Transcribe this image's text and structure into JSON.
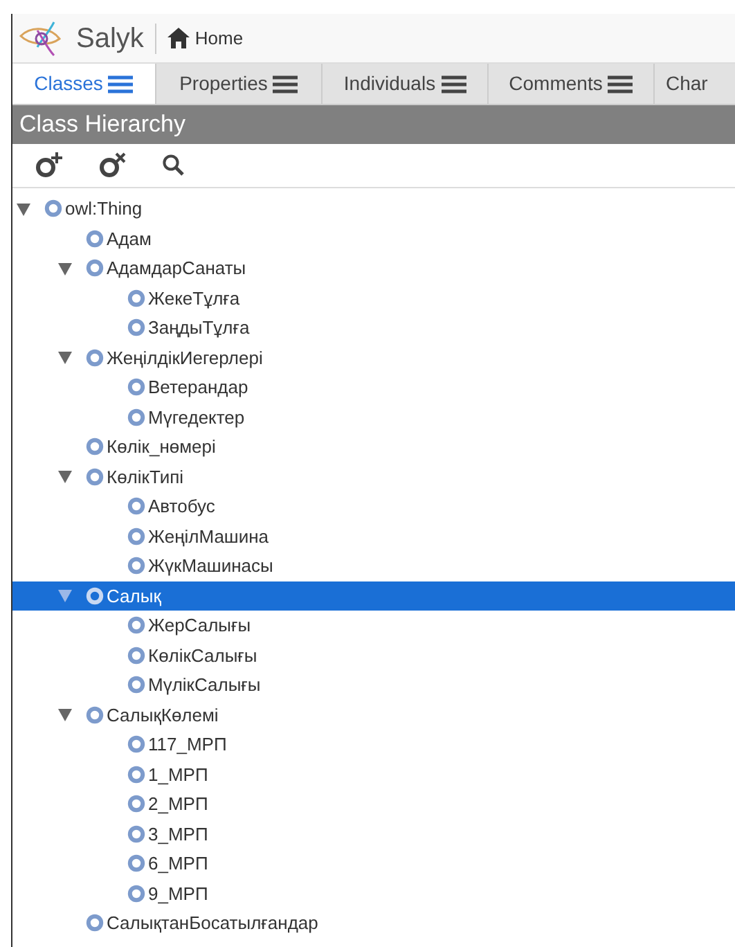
{
  "header": {
    "app_name": "Salyk",
    "home_link": "Home"
  },
  "tabs": [
    {
      "label": "Classes",
      "selected": true
    },
    {
      "label": "Properties",
      "selected": false
    },
    {
      "label": "Individuals",
      "selected": false
    },
    {
      "label": "Comments",
      "selected": false
    },
    {
      "label": "Char",
      "selected": false
    }
  ],
  "panel": {
    "title": "Class Hierarchy"
  },
  "tree": [
    {
      "label": "owl:Thing",
      "selected": false,
      "expanded": true,
      "children": [
        {
          "label": "Адам",
          "selected": false
        },
        {
          "label": "АдамдарСанаты",
          "selected": false,
          "expanded": true,
          "children": [
            {
              "label": "ЖекеТұлға",
              "selected": false
            },
            {
              "label": "ЗаңдыТұлға",
              "selected": false
            }
          ]
        },
        {
          "label": "ЖеңілдікИегерлері",
          "selected": false,
          "expanded": true,
          "children": [
            {
              "label": "Ветерандар",
              "selected": false
            },
            {
              "label": "Мүгедектер",
              "selected": false
            }
          ]
        },
        {
          "label": "Көлік_нөмері",
          "selected": false
        },
        {
          "label": "КөлікТипі",
          "selected": false,
          "expanded": true,
          "children": [
            {
              "label": "Автобус",
              "selected": false
            },
            {
              "label": "ЖеңілМашина",
              "selected": false
            },
            {
              "label": "ЖүкМашинасы",
              "selected": false
            }
          ]
        },
        {
          "label": "Салық",
          "selected": true,
          "expanded": true,
          "children": [
            {
              "label": "ЖерСалығы",
              "selected": false
            },
            {
              "label": "КөлікСалығы",
              "selected": false
            },
            {
              "label": "МүлікСалығы",
              "selected": false
            }
          ]
        },
        {
          "label": "СалықКөлемі",
          "selected": false,
          "expanded": true,
          "children": [
            {
              "label": "117_МРП",
              "selected": false
            },
            {
              "label": "1_МРП",
              "selected": false
            },
            {
              "label": "2_МРП",
              "selected": false
            },
            {
              "label": "3_МРП",
              "selected": false
            },
            {
              "label": "6_МРП",
              "selected": false
            },
            {
              "label": "9_МРП",
              "selected": false
            }
          ]
        },
        {
          "label": "СалықтанБосатылғандар",
          "selected": false
        }
      ]
    }
  ]
}
